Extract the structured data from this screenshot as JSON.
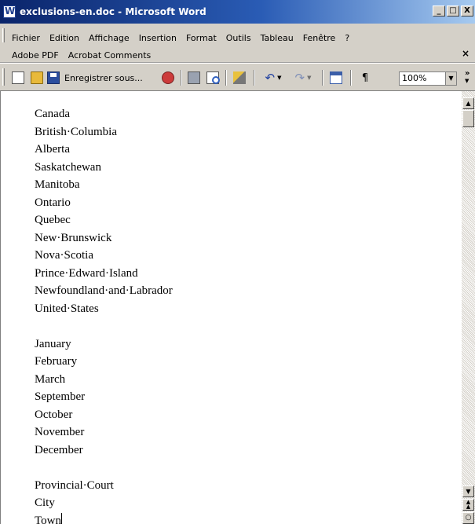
{
  "window": {
    "title": "exclusions-en.doc - Microsoft Word",
    "minimize_label": "_",
    "maximize_label": "□",
    "close_label": "X"
  },
  "menu": {
    "row1": [
      "Fichier",
      "Edition",
      "Affichage",
      "Insertion",
      "Format",
      "Outils",
      "Tableau",
      "Fenêtre",
      "?"
    ],
    "row2": [
      "Adobe PDF",
      "Acrobat Comments"
    ],
    "close_doc_label": "×"
  },
  "toolbar": {
    "save_as_label": "Enregistrer sous...",
    "pilcrow": "¶",
    "zoom_value": "100%",
    "overflow_label": "»"
  },
  "document": {
    "lines": [
      "Canada",
      "British·Columbia",
      "Alberta",
      "Saskatchewan",
      "Manitoba",
      "Ontario",
      "Quebec",
      "New·Brunswick",
      "Nova·Scotia",
      "Prince·Edward·Island",
      "Newfoundland·and·Labrador",
      "United·States",
      "",
      "January",
      "February",
      "March",
      "September",
      "October",
      "November",
      "December",
      "",
      "Provincial·Court",
      "City",
      "Town"
    ]
  },
  "icons": [
    "app-word-icon",
    "new-document-icon",
    "open-folder-icon",
    "save-icon",
    "research-icon",
    "print-icon",
    "print-preview-icon",
    "format-painter-icon",
    "undo-icon",
    "redo-icon",
    "insert-table-icon",
    "show-formatting-icon"
  ]
}
